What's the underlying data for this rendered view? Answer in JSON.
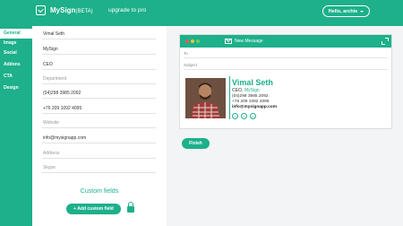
{
  "header": {
    "brand": "MySign",
    "beta": "(BETA)",
    "upgrade": "upgrade to pro",
    "hello": "Hello, archie"
  },
  "sidebar": {
    "items": [
      {
        "label": "General"
      },
      {
        "label": "Image"
      },
      {
        "label": "Social"
      },
      {
        "label": "Addons"
      },
      {
        "label": "CTA"
      },
      {
        "label": "Design"
      }
    ]
  },
  "form": {
    "fields": [
      {
        "value": "Vimal Seth",
        "placeholder": ""
      },
      {
        "value": "MySign",
        "placeholder": ""
      },
      {
        "value": "CEO",
        "placeholder": ""
      },
      {
        "value": "",
        "placeholder": "Department"
      },
      {
        "value": "(04)298 3985 2092",
        "placeholder": ""
      },
      {
        "value": "+76 209 1092 4095",
        "placeholder": ""
      },
      {
        "value": "",
        "placeholder": "Website"
      },
      {
        "value": "info@mysignapp.com",
        "placeholder": ""
      },
      {
        "value": "",
        "placeholder": "Address"
      },
      {
        "value": "",
        "placeholder": "Skype"
      }
    ],
    "custom_fields_title": "Custom fields",
    "add_custom_field": "+ Add custom field"
  },
  "preview": {
    "window_title": "New Message",
    "to_label": "To",
    "subject_label": "Subject",
    "signature": {
      "name": "Vimal Seth",
      "title": "CEO,",
      "company": "MySign",
      "phone1": "(04)298 3985 2092",
      "phone2": "+76 209 1092 4095",
      "email": "info@mysignapp.com"
    },
    "social": [
      {
        "icon": "twitter-icon",
        "glyph": "t"
      },
      {
        "icon": "facebook-icon",
        "glyph": "f"
      },
      {
        "icon": "pinterest-icon",
        "glyph": "p"
      }
    ]
  },
  "finish_label": "Finish",
  "colors": {
    "accent": "#1db08a"
  }
}
